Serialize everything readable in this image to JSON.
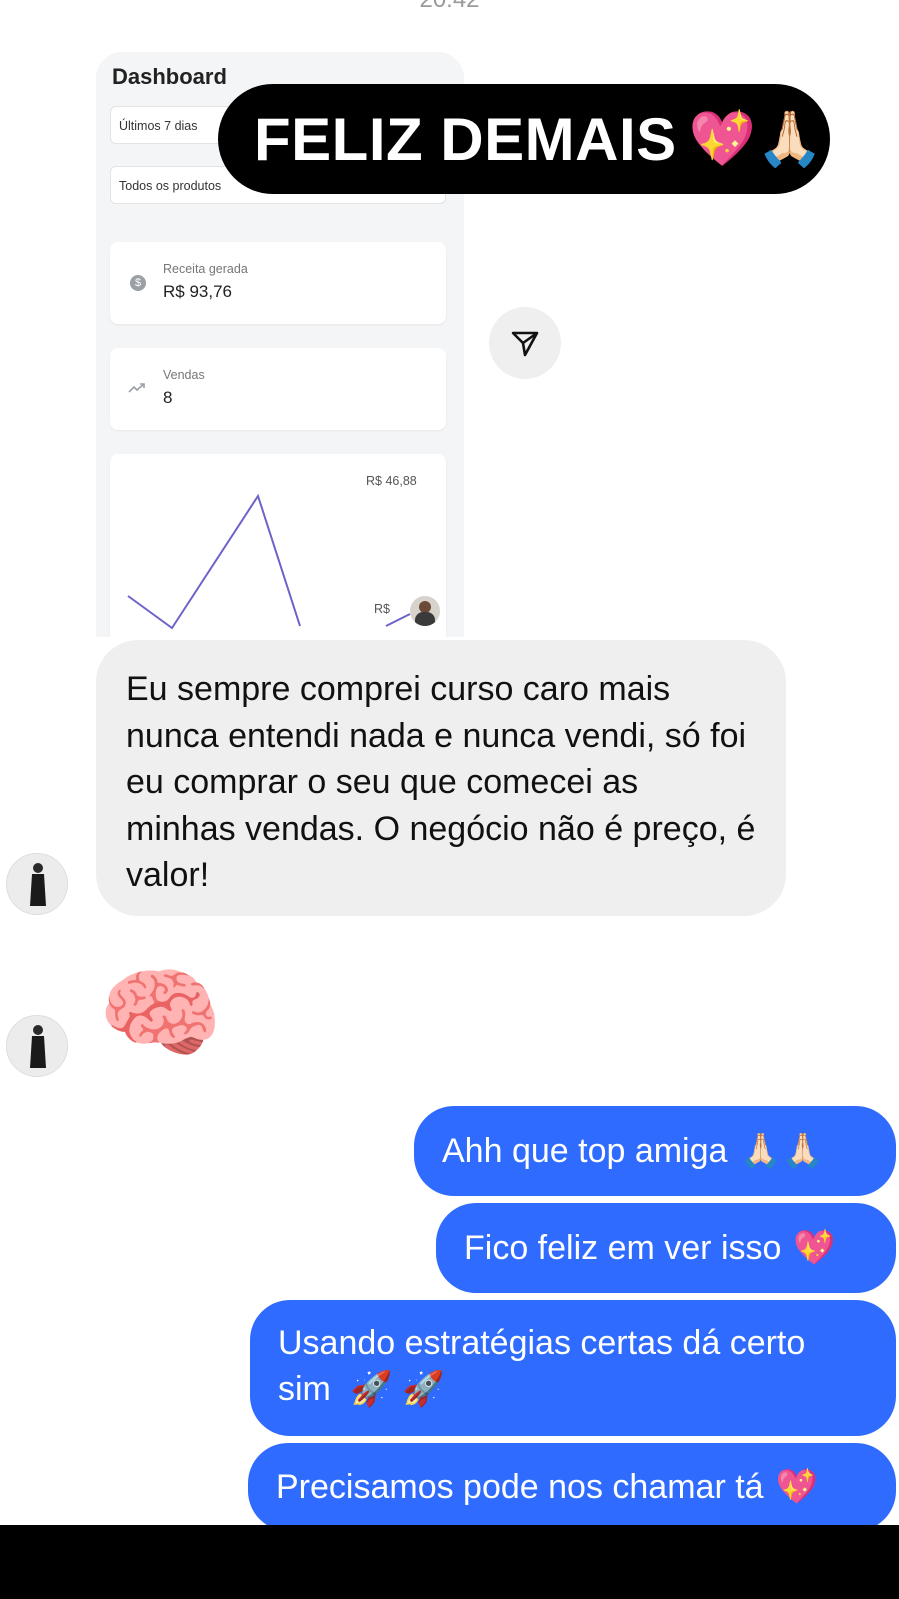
{
  "status": {
    "time": "20:42"
  },
  "shared_screenshot": {
    "title": "Dashboard",
    "filter_period": "Últimos 7 dias",
    "filter_products": "Todos os produtos",
    "revenue_label": "Receita gerada",
    "revenue_value": "R$  93,76",
    "sales_label": "Vendas",
    "sales_value": "8",
    "chart_label_top": "R$  46,88",
    "chart_label_bottom": "R$"
  },
  "sticker": {
    "text": "FELIZ DEMAIS",
    "emoji": "💖🙏🏻"
  },
  "messages": {
    "incoming_text": "Eu sempre comprei curso caro mais nunca entendi nada e nunca vendi, só foi eu comprar o seu que comecei as minhas vendas. O negócio não é preço, é valor!",
    "incoming_emoji": "🧠",
    "outgoing": [
      {
        "text": "Ahh que top amiga",
        "emoji": "🙏🏻🙏🏻"
      },
      {
        "text": "Fico feliz em ver isso",
        "emoji": "💖"
      },
      {
        "text": "Usando estratégias certas dá certo sim",
        "emoji": "🚀 🚀"
      },
      {
        "text": "Precisamos pode nos chamar tá",
        "emoji": "💖"
      }
    ]
  },
  "colors": {
    "outgoing_bubble": "#2f6bff",
    "incoming_bubble": "#efefef",
    "chart_line": "#6b63c9"
  }
}
